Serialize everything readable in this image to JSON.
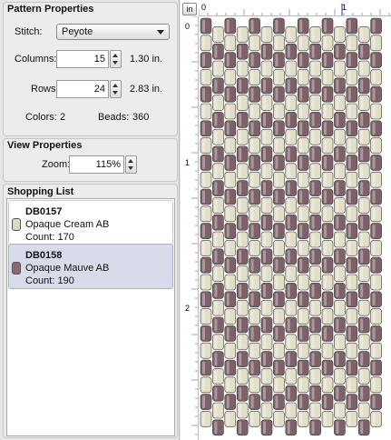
{
  "pattern_properties": {
    "title": "Pattern Properties",
    "stitch_label": "Stitch:",
    "stitch_value": "Peyote",
    "columns_label": "Columns:",
    "columns_value": "15",
    "columns_inches": "1.30 in.",
    "rows_label": "Rows:",
    "rows_value": "24",
    "rows_inches": "2.83 in.",
    "colors_label": "Colors:",
    "colors_value": "2",
    "beads_label": "Beads:",
    "beads_value": "360"
  },
  "view_properties": {
    "title": "View Properties",
    "zoom_label": "Zoom:",
    "zoom_value": "115%"
  },
  "shopping_list": {
    "title": "Shopping List",
    "items": [
      {
        "code": "DB0157",
        "name": "Opaque Cream AB",
        "count": "Count: 170",
        "color": "#dcd8c0",
        "selected": false
      },
      {
        "code": "DB0158",
        "name": "Opaque Mauve AB",
        "count": "Count: 190",
        "color": "#8a6a72",
        "selected": true
      }
    ]
  },
  "canvas": {
    "unit_button": "in",
    "hruler_labels": [
      "0",
      "1"
    ],
    "vruler_labels": [
      "0",
      "1",
      "2"
    ],
    "colors": {
      "cream": "#e2dfc8",
      "mauve": "#7e6068"
    }
  }
}
